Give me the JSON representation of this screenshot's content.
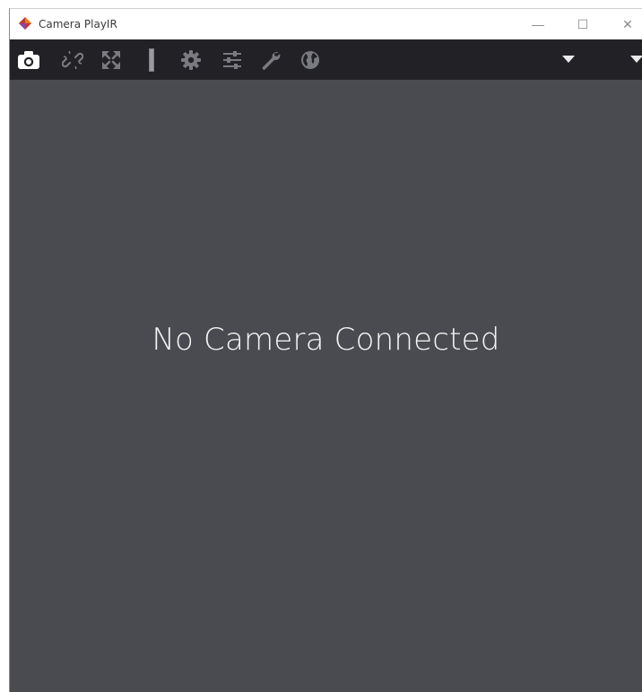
{
  "window": {
    "title": "Camera PlayIR",
    "controls": {
      "minimize": "—",
      "maximize": "☐",
      "close": "✕"
    }
  },
  "toolbar": {
    "icons": [
      "camera-icon",
      "link-broken-icon",
      "fullscreen-icon",
      "level-bar-icon",
      "gear-icon",
      "sliders-icon",
      "wrench-icon",
      "globe-icon"
    ],
    "dropdowns": [
      "dropdown-1",
      "dropdown-2"
    ]
  },
  "content": {
    "message": "No Camera Connected"
  },
  "colors": {
    "toolbar_bg": "#222226",
    "content_bg": "#4a4b50",
    "icon_active": "#ffffff",
    "icon_inactive": "#7a7b80",
    "app_icon_red": "#c0392b",
    "app_icon_orange": "#e67e22"
  }
}
